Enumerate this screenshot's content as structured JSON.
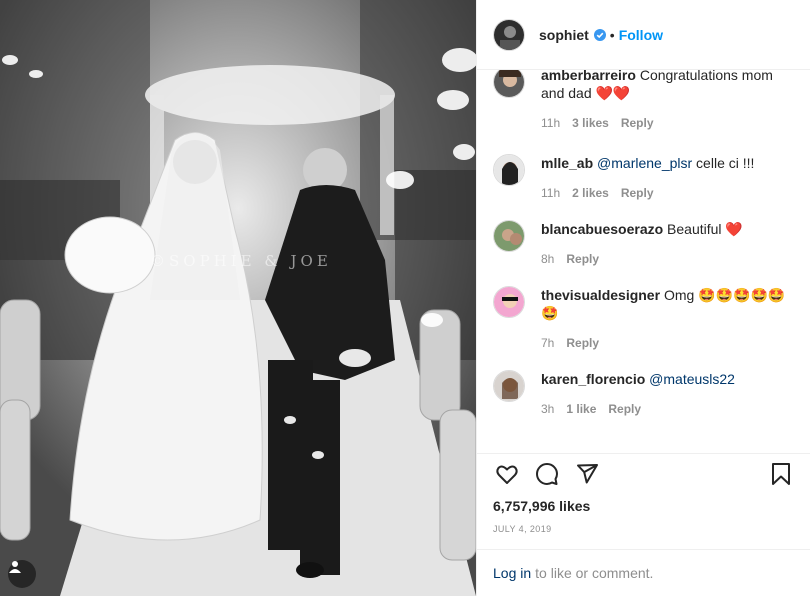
{
  "post": {
    "username": "sophiet",
    "separator": "•",
    "follow_label": "Follow",
    "watermark": "©SOPHIE & JOE",
    "likes": "6,757,996 likes",
    "date": "JULY 4, 2019",
    "login_link": "Log in",
    "login_rest": "to like or comment."
  },
  "comments": [
    {
      "user": "amberbarreiro",
      "text": "Congratulations mom and dad ❤️❤️",
      "time": "11h",
      "likes": "3 likes",
      "reply": "Reply"
    },
    {
      "user": "mlle_ab",
      "mention": "@marlene_plsr",
      "text": " celle ci !!!",
      "time": "11h",
      "likes": "2 likes",
      "reply": "Reply"
    },
    {
      "user": "blancabuesoerazo",
      "text": "Beautiful ❤️",
      "time": "8h",
      "reply": "Reply"
    },
    {
      "user": "thevisualdesigner",
      "text": "Omg 🤩🤩🤩🤩🤩🤩",
      "time": "7h",
      "reply": "Reply"
    },
    {
      "user": "karen_florencio",
      "mention": "@mateusls22",
      "text": "",
      "time": "3h",
      "likes": "1 like",
      "reply": "Reply"
    }
  ],
  "colors": {
    "accent": "#0095f6",
    "mention": "#00376b",
    "muted": "#8e8e8e",
    "heart": "#ed4956"
  },
  "icons": [
    "verified-badge-icon",
    "heart-icon",
    "comment-icon",
    "share-icon",
    "bookmark-icon",
    "user-tag-icon"
  ]
}
